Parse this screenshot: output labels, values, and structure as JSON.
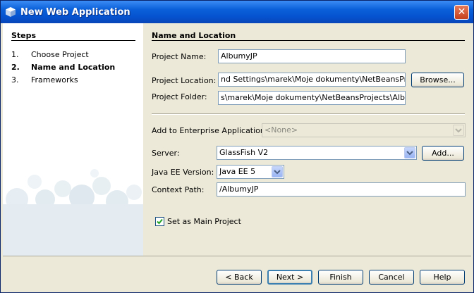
{
  "window": {
    "title": "New Web Application",
    "close_glyph": "✕"
  },
  "steps": {
    "title": "Steps",
    "items": [
      {
        "num": "1.",
        "label": "Choose Project"
      },
      {
        "num": "2.",
        "label": "Name and Location"
      },
      {
        "num": "3.",
        "label": "Frameworks"
      }
    ]
  },
  "section": {
    "title": "Name and Location"
  },
  "form": {
    "project_name_label": "Project Name:",
    "project_name_value": "AlbumyJP",
    "project_location_label": "Project Location:",
    "project_location_value": "nd Settings\\marek\\Moje dokumenty\\NetBeansProjects",
    "browse_label": "Browse...",
    "project_folder_label": "Project Folder:",
    "project_folder_value": "s\\marek\\Moje dokumenty\\NetBeansProjects\\AlbumyJP",
    "enterprise_label": "Add to Enterprise Application:",
    "enterprise_value": "<None>",
    "server_label": "Server:",
    "server_value": "GlassFish V2",
    "add_label": "Add...",
    "javaee_label": "Java EE Version:",
    "javaee_value": "Java EE 5",
    "context_label": "Context Path:",
    "context_value": "/AlbumyJP",
    "main_project_label": "Set as Main Project",
    "main_project_checked": true
  },
  "buttons": {
    "back": "< Back",
    "next": "Next >",
    "finish": "Finish",
    "cancel": "Cancel",
    "help": "Help"
  },
  "colors": {
    "title_bar": "#0653d0",
    "panel": "#ece9d8",
    "field_border": "#7f9db9"
  }
}
